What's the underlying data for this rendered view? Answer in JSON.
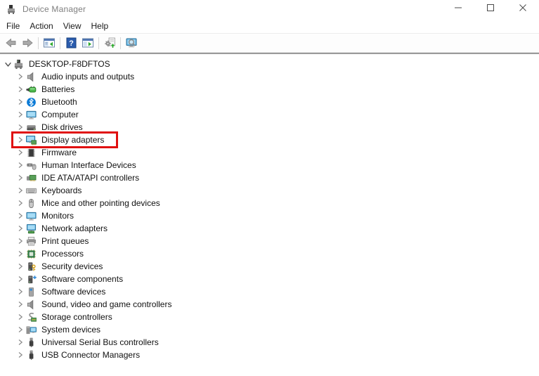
{
  "window": {
    "title": "Device Manager",
    "controls": [
      {
        "name": "minimize",
        "icon": "minimize-icon"
      },
      {
        "name": "maximize",
        "icon": "maximize-icon"
      },
      {
        "name": "close",
        "icon": "close-icon"
      }
    ]
  },
  "menu_bar": {
    "items": [
      "File",
      "Action",
      "View",
      "Help"
    ]
  },
  "toolbar": {
    "items": [
      "back-arrow",
      "forward-arrow",
      "|",
      "console-tree",
      "|",
      "help",
      "properties",
      "|",
      "scan-hardware",
      "|",
      "search-computer"
    ]
  },
  "tree": {
    "root": {
      "label": "DESKTOP-F8DFTOS",
      "icon": "computer-device",
      "expanded": true
    },
    "items": [
      {
        "label": "Audio inputs and outputs",
        "icon": "audio"
      },
      {
        "label": "Batteries",
        "icon": "battery"
      },
      {
        "label": "Bluetooth",
        "icon": "bluetooth"
      },
      {
        "label": "Computer",
        "icon": "monitor"
      },
      {
        "label": "Disk drives",
        "icon": "disk-drive"
      },
      {
        "label": "Display adapters",
        "icon": "display-adapter",
        "highlighted": true
      },
      {
        "label": "Firmware",
        "icon": "firmware"
      },
      {
        "label": "Human Interface Devices",
        "icon": "hid"
      },
      {
        "label": "IDE ATA/ATAPI controllers",
        "icon": "ide-controller"
      },
      {
        "label": "Keyboards",
        "icon": "keyboard"
      },
      {
        "label": "Mice and other pointing devices",
        "icon": "mouse"
      },
      {
        "label": "Monitors",
        "icon": "monitor"
      },
      {
        "label": "Network adapters",
        "icon": "network-adapter"
      },
      {
        "label": "Print queues",
        "icon": "printer"
      },
      {
        "label": "Processors",
        "icon": "processor"
      },
      {
        "label": "Security devices",
        "icon": "security-device"
      },
      {
        "label": "Software components",
        "icon": "software-component"
      },
      {
        "label": "Software devices",
        "icon": "software-device"
      },
      {
        "label": "Sound, video and game controllers",
        "icon": "audio"
      },
      {
        "label": "Storage controllers",
        "icon": "storage-controller"
      },
      {
        "label": "System devices",
        "icon": "system-device"
      },
      {
        "label": "Universal Serial Bus controllers",
        "icon": "usb-plug"
      },
      {
        "label": "USB Connector Managers",
        "icon": "usb-plug"
      }
    ]
  },
  "colors": {
    "highlight_box": "#e01010",
    "title_text": "#7f7f7f",
    "monitor_blue": "#5db6e8",
    "device_green": "#58a058"
  }
}
